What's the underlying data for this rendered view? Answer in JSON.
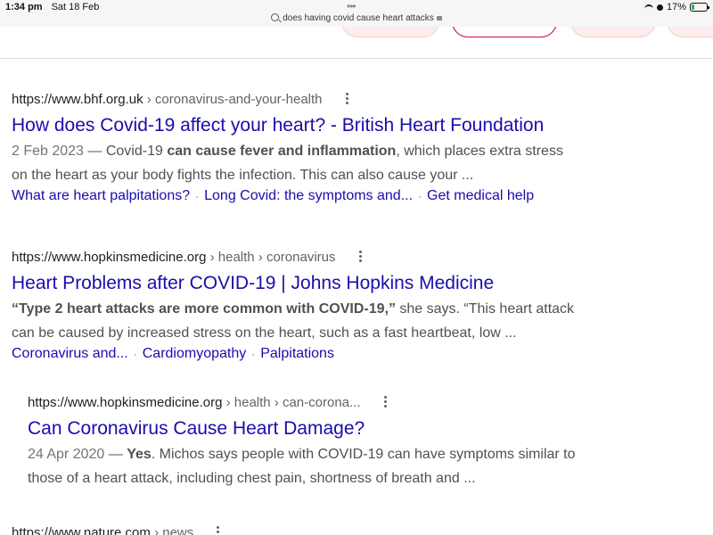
{
  "status_bar": {
    "time": "1:34 pm",
    "date": "Sat 18 Feb",
    "battery": "17%",
    "battery_level": 0.17,
    "url": "does having covid cause heart attacks"
  },
  "results": [
    {
      "domain": "https://www.bhf.org.uk",
      "path": " › coronavirus-and-your-health",
      "title": "How does Covid-19 affect your heart? - British Heart Foundation",
      "date": "2 Feb 2023",
      "snippet_pre": " — Covid-19 ",
      "snippet_bold": "can cause fever and inflammation",
      "snippet_post": ", which places extra stress",
      "snippet_line2": "on the heart as your body fights the infection. This can also cause your ...",
      "sitelinks": [
        "What are heart palpitations?",
        "Long Covid: the symptoms and...",
        "Get medical help"
      ]
    },
    {
      "domain": "https://www.hopkinsmedicine.org",
      "path": " › health › coronavirus",
      "title": "Heart Problems after COVID-19 | Johns Hopkins Medicine",
      "snippet_bold": "“Type 2 heart attacks are more common with COVID-19,”",
      "snippet_post": " she says. “This heart attack",
      "snippet_line2": "can be caused by increased stress on the heart, such as a fast heartbeat, low ...",
      "sitelinks": [
        "Coronavirus and...",
        "Cardiomyopathy",
        "Palpitations"
      ]
    },
    {
      "domain": "https://www.hopkinsmedicine.org",
      "path": " › health › can-corona...",
      "title": "Can Coronavirus Cause Heart Damage?",
      "date": "24 Apr 2020",
      "snippet_pre": " — ",
      "snippet_bold": "Yes",
      "snippet_post": ". Michos says people with COVID-19 can have symptoms similar to",
      "snippet_line2": "those of a heart attack, including chest pain, shortness of breath and ..."
    },
    {
      "domain": "https://www.nature.com",
      "path": " › news"
    }
  ]
}
